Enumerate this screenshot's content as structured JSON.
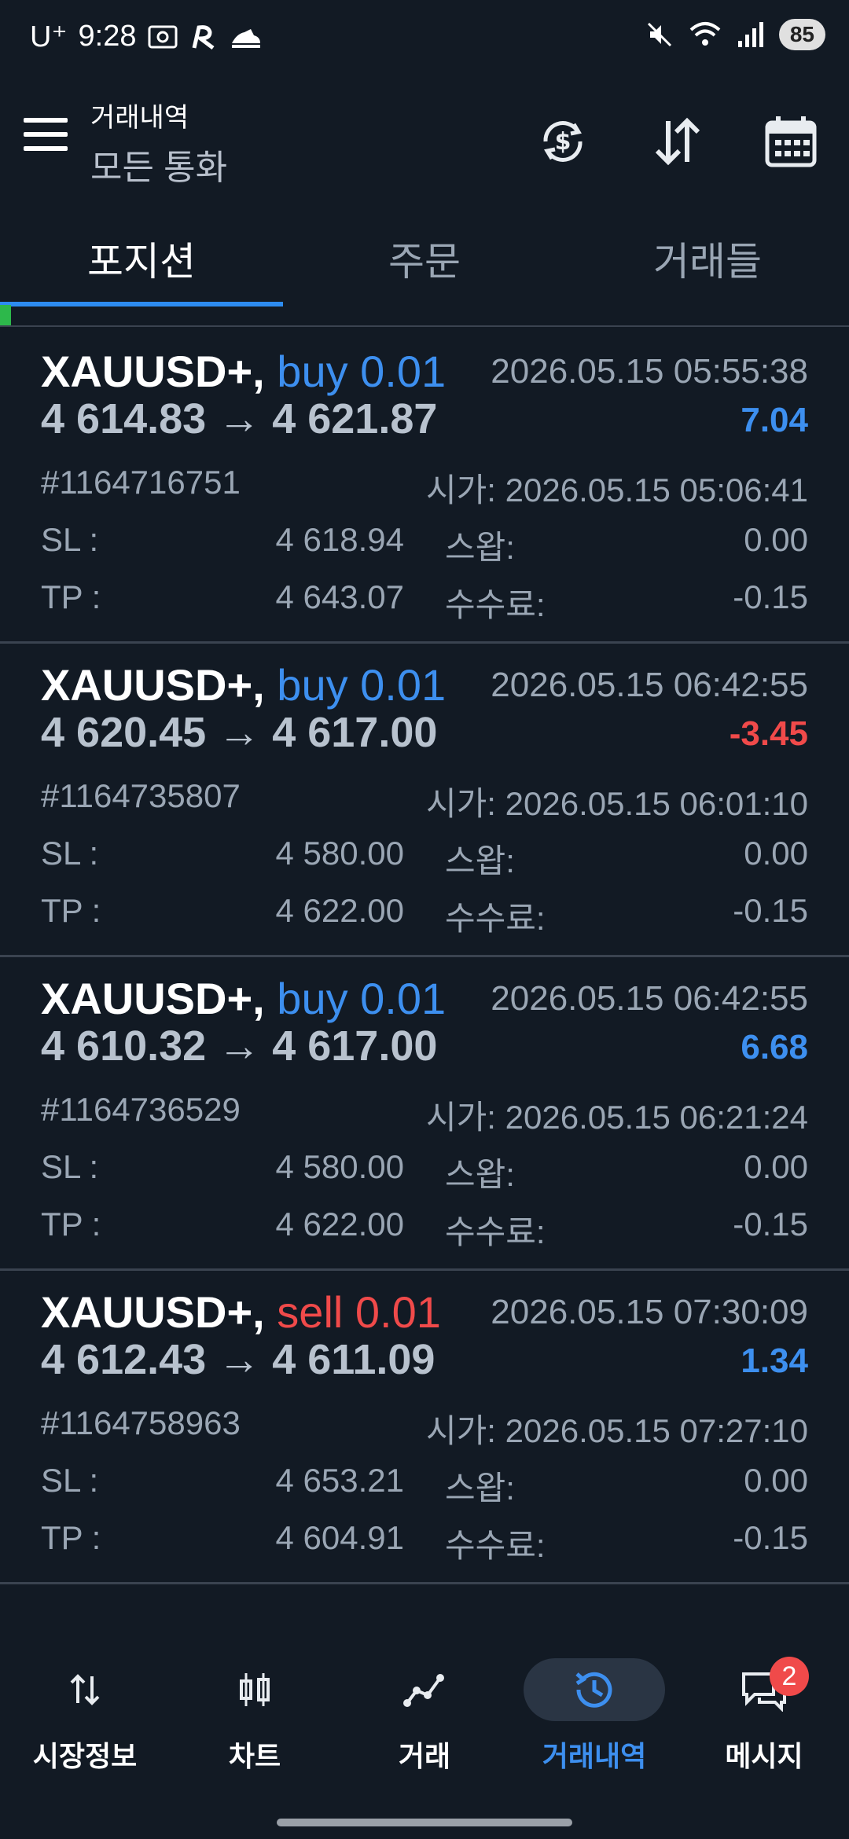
{
  "status_bar": {
    "carrier": "U⁺",
    "time": "9:28",
    "battery": "85"
  },
  "app_bar": {
    "subtitle": "거래내역",
    "title": "모든 통화"
  },
  "tabs": [
    {
      "label": "포지션",
      "active": true
    },
    {
      "label": "주문",
      "active": false
    },
    {
      "label": "거래들",
      "active": false
    }
  ],
  "positions": [
    {
      "symbol": "XAUUSD+,",
      "side": "buy 0.01",
      "side_type": "buy",
      "close_time": "2026.05.15 05:55:38",
      "prices": "4 614.83 → 4 621.87",
      "profit": "7.04",
      "profit_type": "positive",
      "ticket": "#1164716751",
      "open_time": "시가: 2026.05.15 05:06:41",
      "sl_label": "SL :",
      "sl": "4 618.94",
      "tp_label": "TP :",
      "tp": "4 643.07",
      "swap_label": "스왑:",
      "swap": "0.00",
      "commission_label": "수수료:",
      "commission": "-0.15"
    },
    {
      "symbol": "XAUUSD+,",
      "side": "buy 0.01",
      "side_type": "buy",
      "close_time": "2026.05.15 06:42:55",
      "prices": "4 620.45 → 4 617.00",
      "profit": "-3.45",
      "profit_type": "negative",
      "ticket": "#1164735807",
      "open_time": "시가: 2026.05.15 06:01:10",
      "sl_label": "SL :",
      "sl": "4 580.00",
      "tp_label": "TP :",
      "tp": "4 622.00",
      "swap_label": "스왑:",
      "swap": "0.00",
      "commission_label": "수수료:",
      "commission": "-0.15"
    },
    {
      "symbol": "XAUUSD+,",
      "side": "buy 0.01",
      "side_type": "buy",
      "close_time": "2026.05.15 06:42:55",
      "prices": "4 610.32 → 4 617.00",
      "profit": "6.68",
      "profit_type": "positive",
      "ticket": "#1164736529",
      "open_time": "시가: 2026.05.15 06:21:24",
      "sl_label": "SL :",
      "sl": "4 580.00",
      "tp_label": "TP :",
      "tp": "4 622.00",
      "swap_label": "스왑:",
      "swap": "0.00",
      "commission_label": "수수료:",
      "commission": "-0.15"
    },
    {
      "symbol": "XAUUSD+,",
      "side": "sell 0.01",
      "side_type": "sell",
      "close_time": "2026.05.15 07:30:09",
      "prices": "4 612.43 → 4 611.09",
      "profit": "1.34",
      "profit_type": "positive",
      "ticket": "#1164758963",
      "open_time": "시가: 2026.05.15 07:27:10",
      "sl_label": "SL :",
      "sl": "4 653.21",
      "tp_label": "TP :",
      "tp": "4 604.91",
      "swap_label": "스왑:",
      "swap": "0.00",
      "commission_label": "수수료:",
      "commission": "-0.15"
    }
  ],
  "bottom_nav": [
    {
      "label": "시장정보",
      "icon": "updown-arrows-icon"
    },
    {
      "label": "차트",
      "icon": "candlestick-icon"
    },
    {
      "label": "거래",
      "icon": "trade-line-icon"
    },
    {
      "label": "거래내역",
      "icon": "history-icon",
      "active": true
    },
    {
      "label": "메시지",
      "icon": "chat-icon",
      "badge": "2"
    }
  ],
  "colors": {
    "background": "#121a24",
    "accent": "#3d8fef",
    "negative": "#f04a4a",
    "muted": "#9aa6b4"
  }
}
